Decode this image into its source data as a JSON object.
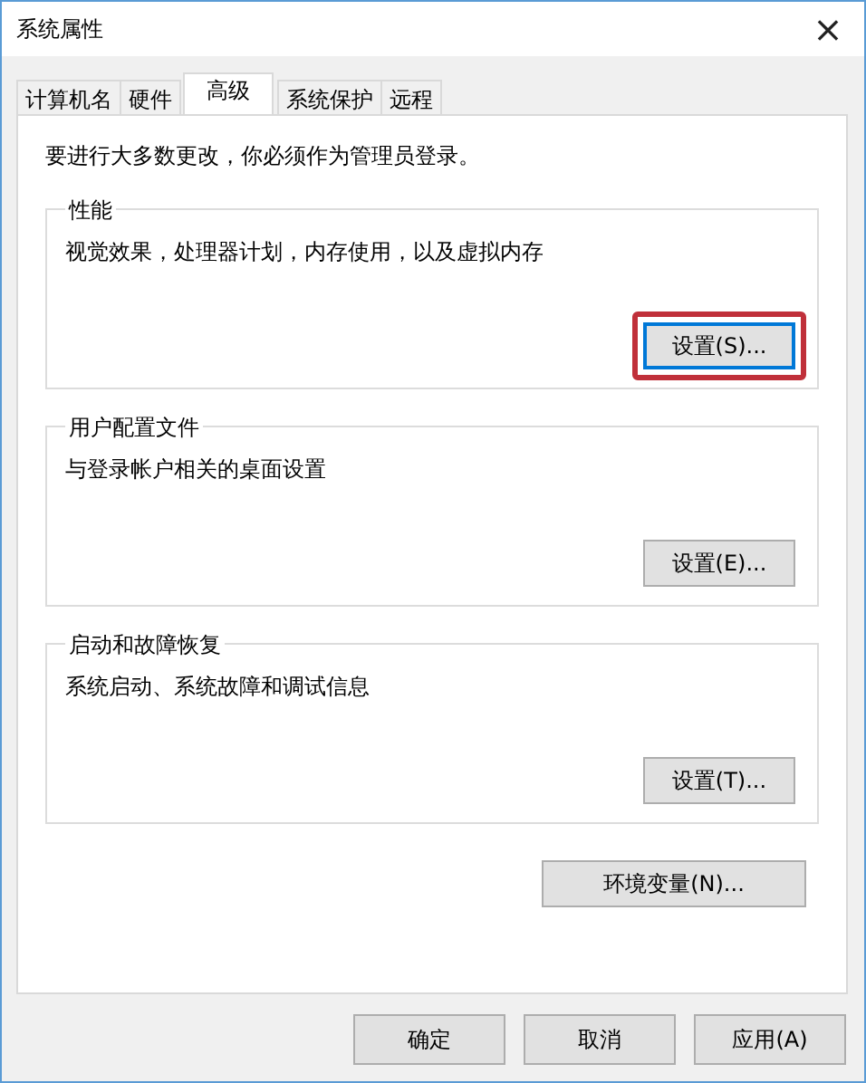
{
  "window": {
    "title": "系统属性",
    "close": "×"
  },
  "tabs": [
    {
      "label": "计算机名",
      "selected": false
    },
    {
      "label": "硬件",
      "selected": false
    },
    {
      "label": "高级",
      "selected": true
    },
    {
      "label": "系统保护",
      "selected": false
    },
    {
      "label": "远程",
      "selected": false
    }
  ],
  "notice": "要进行大多数更改，你必须作为管理员登录。",
  "groups": [
    {
      "title": "性能",
      "description": "视觉效果，处理器计划，内存使用，以及虚拟内存",
      "button": {
        "label": "设置(S)...",
        "highlighted": true
      }
    },
    {
      "title": "用户配置文件",
      "description": "与登录帐户相关的桌面设置",
      "button": {
        "label": "设置(E)...",
        "highlighted": false
      }
    },
    {
      "title": "启动和故障恢复",
      "description": "系统启动、系统故障和调试信息",
      "button": {
        "label": "设置(T)...",
        "highlighted": false
      }
    }
  ],
  "env_button": "环境变量(N)...",
  "buttons": [
    "确定",
    "取消",
    "应用(A)"
  ]
}
